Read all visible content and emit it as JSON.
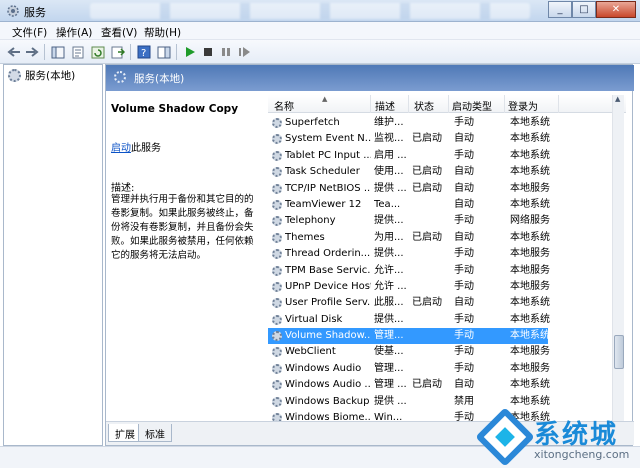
{
  "window": {
    "title": "服务",
    "controls": [
      "_",
      "□",
      "✕"
    ]
  },
  "menu": [
    "文件(F)",
    "操作(A)",
    "查看(V)",
    "帮助(H)"
  ],
  "tree": {
    "root": "服务(本地)"
  },
  "header": {
    "title": "服务(本地)"
  },
  "description": {
    "service_name": "Volume Shadow Copy",
    "link": "启动",
    "link_suffix": "此服务",
    "label": "描述:",
    "text": "管理并执行用于备份和其它目的的卷影复制。如果此服务被终止，备份将没有卷影复制，并且备份会失败。如果此服务被禁用，任何依赖它的服务将无法启动。"
  },
  "columns": [
    "名称",
    "描述",
    "状态",
    "启动类型",
    "登录为"
  ],
  "services": [
    [
      "Superfetch",
      "维护...",
      "",
      "手动",
      "本地系统"
    ],
    [
      "System Event N...",
      "监视...",
      "已启动",
      "自动",
      "本地系统"
    ],
    [
      "Tablet PC Input ...",
      "启用 ...",
      "",
      "手动",
      "本地系统"
    ],
    [
      "Task Scheduler",
      "使用...",
      "已启动",
      "自动",
      "本地系统"
    ],
    [
      "TCP/IP NetBIOS ...",
      "提供 ...",
      "已启动",
      "自动",
      "本地服务"
    ],
    [
      "TeamViewer 12",
      "Tea...",
      "",
      "自动",
      "本地系统"
    ],
    [
      "Telephony",
      "提供...",
      "",
      "手动",
      "网络服务"
    ],
    [
      "Themes",
      "为用...",
      "已启动",
      "自动",
      "本地系统"
    ],
    [
      "Thread Orderin...",
      "提供...",
      "",
      "手动",
      "本地服务"
    ],
    [
      "TPM Base Servic...",
      "允许...",
      "",
      "手动",
      "本地服务"
    ],
    [
      "UPnP Device Host",
      "允许 ...",
      "",
      "手动",
      "本地服务"
    ],
    [
      "User Profile Serv...",
      "此服...",
      "已启动",
      "自动",
      "本地系统"
    ],
    [
      "Virtual Disk",
      "提供...",
      "",
      "手动",
      "本地系统"
    ],
    [
      "Volume Shadow...",
      "管理...",
      "",
      "手动",
      "本地系统"
    ],
    [
      "WebClient",
      "使基...",
      "",
      "手动",
      "本地服务"
    ],
    [
      "Windows Audio",
      "管理...",
      "",
      "手动",
      "本地服务"
    ],
    [
      "Windows Audio ...",
      "管理 ...",
      "已启动",
      "自动",
      "本地系统"
    ],
    [
      "Windows Backup",
      "提供 ...",
      "",
      "禁用",
      "本地系统"
    ],
    [
      "Windows Biome...",
      "Win...",
      "",
      "手动",
      "本地系统"
    ]
  ],
  "selected_index": 13,
  "tabs": [
    "扩展",
    "标准"
  ],
  "watermark": {
    "brand": "系统城",
    "url": "xitongcheng.com"
  },
  "colors": {
    "selection": "#3399ff",
    "header": "#5a82bf",
    "link": "#0b52c6"
  }
}
